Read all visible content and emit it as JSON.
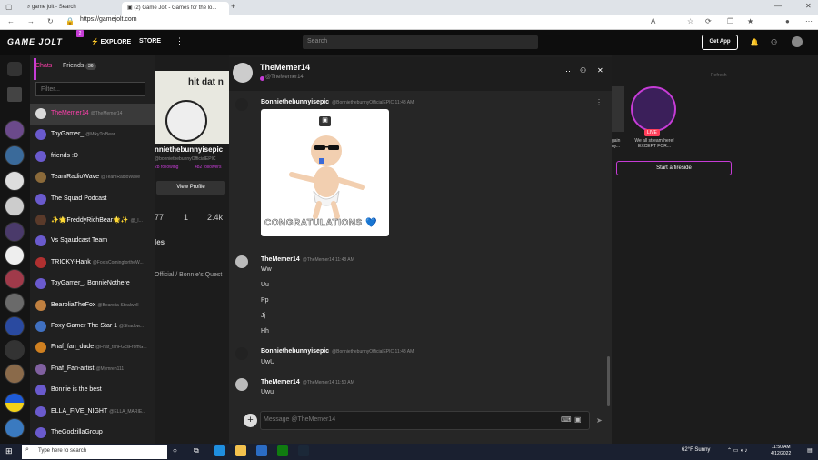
{
  "browser": {
    "tabs": [
      {
        "label": "game jolt - Search"
      },
      {
        "label": "(2) Game Jolt - Games for the lo..."
      }
    ],
    "url": "https://gamejolt.com"
  },
  "site_header": {
    "logo": "GAME JOLT",
    "notification_count": "2",
    "explore": "EXPLORE",
    "store": "STORE",
    "search_placeholder": "Search",
    "get_app": "Get App"
  },
  "sidebar": {
    "chats_tab": "Chats",
    "friends_tab": "Friends",
    "friends_count": "36",
    "filter_placeholder": "Filter...",
    "chats": [
      {
        "name": "TheMemer14",
        "user": "@TheMemer14",
        "color": "#d9d9d9"
      },
      {
        "name": "ToyGamer_",
        "user": "@MikyToiBear",
        "color": "#6a5acd"
      },
      {
        "name": "friends :D",
        "user": "",
        "color": "#6a5acd"
      },
      {
        "name": "TeamRadioWave",
        "user": "@TeamRadioWave",
        "color": "#8b6a3a"
      },
      {
        "name": "The Squad Podcast",
        "user": "",
        "color": "#6a5acd"
      },
      {
        "name": "✨🌟FreddyRichBear🌟✨",
        "user": "@_I...",
        "color": "#5a3a2a"
      },
      {
        "name": "Vs Sqaudcast Team",
        "user": "",
        "color": "#6a5acd"
      },
      {
        "name": "TRICKY-Hank",
        "user": "@FoxIsComingfortheW...",
        "color": "#b03030"
      },
      {
        "name": "ToyGamer_, BonnieNothere",
        "user": "",
        "color": "#6a5acd"
      },
      {
        "name": "BearoliaTheFox",
        "user": "@Bearolia-Stealwell",
        "color": "#c08040"
      },
      {
        "name": "Foxy Gamer The Star 1",
        "user": "@Shadow...",
        "color": "#4070c0"
      },
      {
        "name": "Fnaf_fan_dude",
        "user": "@Fnaf_fanFGcsFromG...",
        "color": "#d08020"
      },
      {
        "name": "Fnaf_Fan-artist",
        "user": "@Mymreh111",
        "color": "#8060a0"
      },
      {
        "name": "Bonnie is the best",
        "user": "",
        "color": "#6a5acd"
      },
      {
        "name": "ELLA_FIVE_NIGHT",
        "user": "@ELLA_MARIE...",
        "color": "#6a5acd"
      },
      {
        "name": "TheGodzillaGroup",
        "user": "",
        "color": "#6a5acd"
      }
    ]
  },
  "background_profile": {
    "banner_text": "hit dat n",
    "name": "nniethebunnyisepic",
    "handle": "@bonniethebunnyOfficialEPIC",
    "following": "28 following",
    "followers": "482 followers",
    "view_profile": "View Profile",
    "stat1": "77",
    "stat2": "1",
    "stat3": "2.4k",
    "section": "les",
    "community": "Official / Bonnie's Quest"
  },
  "right_panel": {
    "refresh": "Refresh",
    "live_badge": "LIVE",
    "live_caption": "We all stream here! EXCEPT FOR...",
    "left_caption": "gain ny...",
    "fireside_button": "Start a fireside"
  },
  "chat": {
    "title": "TheMemer14",
    "subtitle": "@TheMemer14",
    "messages": [
      {
        "name": "Bonniethebunnyisepic",
        "meta": "@BonniethebunnyOfficialEPIC 11:48 AM",
        "lines": []
      },
      {
        "name": "TheMemer14",
        "meta": "@TheMemer14 11:48 AM",
        "lines": [
          "Ww",
          "Uu",
          "Pp",
          "Jj",
          "Hh"
        ]
      },
      {
        "name": "Bonniethebunnyisepic",
        "meta": "@BonniethebunnyOfficialEPIC 11:48 AM",
        "lines": [
          "UwU"
        ]
      },
      {
        "name": "TheMemer14",
        "meta": "@TheMemer14 11:50 AM",
        "lines": [
          "Uwu"
        ]
      }
    ],
    "gif_caption": "CONGRATULATIONS 💙",
    "input_placeholder": "Message @TheMemer14"
  },
  "taskbar": {
    "search_placeholder": "Type here to search",
    "weather": "62°F  Sunny",
    "time": "11:50 AM",
    "date": "4/12/2022"
  }
}
